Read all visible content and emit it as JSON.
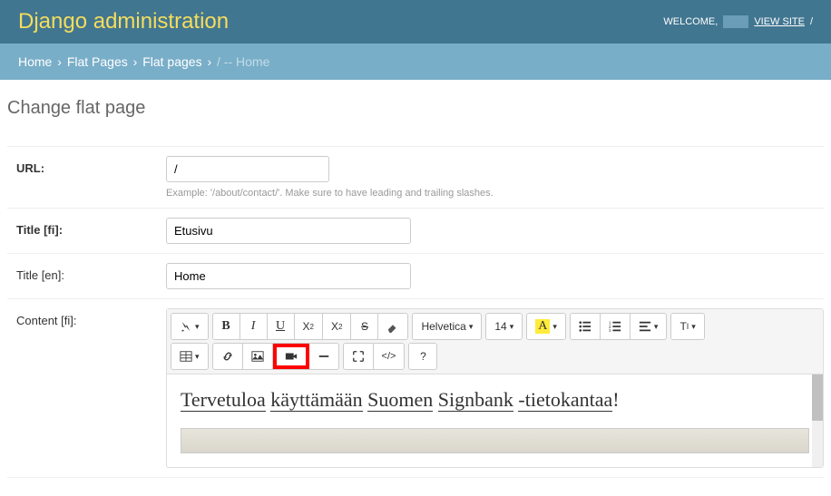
{
  "header": {
    "title": "Django administration",
    "welcome": "WELCOME,",
    "viewsite": "VIEW SITE",
    "slash": "/"
  },
  "breadcrumb": {
    "home": "Home",
    "flatpages_app": "Flat Pages",
    "flatpages": "Flat pages",
    "current": "/ -- Home"
  },
  "page": {
    "title": "Change flat page"
  },
  "fields": {
    "url_label": "URL:",
    "url_value": "/",
    "url_help": "Example: '/about/contact/'. Make sure to have leading and trailing slashes.",
    "title_fi_label": "Title [fi]:",
    "title_fi_value": "Etusivu",
    "title_en_label": "Title [en]:",
    "title_en_value": "Home",
    "content_fi_label": "Content [fi]:"
  },
  "toolbar": {
    "font_family": "Helvetica",
    "font_size": "14",
    "bold": "B",
    "italic": "I",
    "underline": "U",
    "super": "X",
    "sub": "X",
    "strike": "S",
    "color_a": "A",
    "paragraph_t": "T",
    "help": "?"
  },
  "editor": {
    "welcome_1": "Tervetuloa",
    "welcome_2": "käyttämään",
    "welcome_3": "Suomen",
    "welcome_4": "Signbank",
    "welcome_5": "-tietokantaa",
    "welcome_6": "!"
  }
}
